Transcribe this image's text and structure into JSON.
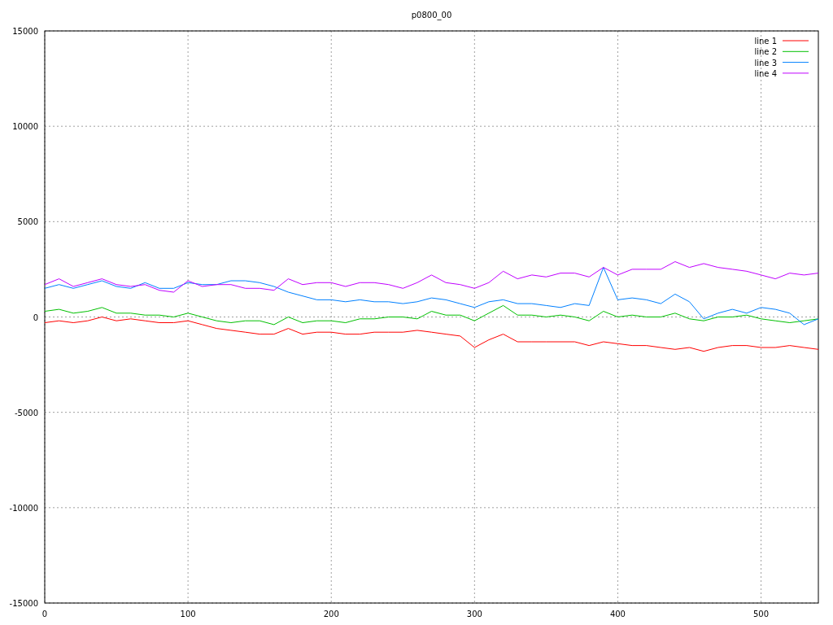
{
  "chart_data": {
    "type": "line",
    "title": "p0800_00",
    "x": [
      0,
      10,
      20,
      30,
      40,
      50,
      60,
      70,
      80,
      90,
      100,
      110,
      120,
      130,
      140,
      150,
      160,
      170,
      180,
      190,
      200,
      210,
      220,
      230,
      240,
      250,
      260,
      270,
      280,
      290,
      300,
      310,
      320,
      330,
      340,
      350,
      360,
      370,
      380,
      390,
      400,
      410,
      420,
      430,
      440,
      450,
      460,
      470,
      480,
      490,
      500,
      510,
      520,
      530,
      540
    ],
    "grid": true,
    "legend": true,
    "xlim": [
      0,
      540
    ],
    "ylim": [
      -15000,
      15000
    ],
    "xticks": [
      0,
      100,
      200,
      300,
      400,
      500
    ],
    "yticks": [
      -15000,
      -10000,
      -5000,
      0,
      5000,
      10000,
      15000
    ],
    "series": [
      {
        "name": "line 1",
        "color": "#ff0000",
        "values": [
          -300,
          -200,
          -300,
          -200,
          0,
          -200,
          -100,
          -200,
          -300,
          -300,
          -200,
          -400,
          -600,
          -700,
          -800,
          -900,
          -900,
          -600,
          -900,
          -800,
          -800,
          -900,
          -900,
          -800,
          -800,
          -800,
          -700,
          -800,
          -900,
          -1000,
          -1600,
          -1200,
          -900,
          -1300,
          -1300,
          -1300,
          -1300,
          -1300,
          -1500,
          -1300,
          -1400,
          -1500,
          -1500,
          -1600,
          -1700,
          -1600,
          -1800,
          -1600,
          -1500,
          -1500,
          -1600,
          -1600,
          -1500,
          -1600,
          -1700
        ]
      },
      {
        "name": "line 2",
        "color": "#00c000",
        "values": [
          300,
          400,
          200,
          300,
          500,
          200,
          200,
          100,
          100,
          0,
          200,
          0,
          -200,
          -300,
          -200,
          -200,
          -400,
          0,
          -300,
          -200,
          -200,
          -300,
          -100,
          -100,
          0,
          0,
          -100,
          300,
          100,
          100,
          -200,
          200,
          600,
          100,
          100,
          0,
          100,
          0,
          -200,
          300,
          0,
          100,
          0,
          0,
          200,
          -100,
          -200,
          0,
          0,
          100,
          -100,
          -200,
          -300,
          -200,
          -100
        ]
      },
      {
        "name": "line 3",
        "color": "#0080ff",
        "values": [
          1500,
          1700,
          1500,
          1700,
          1900,
          1600,
          1500,
          1800,
          1500,
          1500,
          1800,
          1700,
          1700,
          1900,
          1900,
          1800,
          1600,
          1300,
          1100,
          900,
          900,
          800,
          900,
          800,
          800,
          700,
          800,
          1000,
          900,
          700,
          500,
          800,
          900,
          700,
          700,
          600,
          500,
          700,
          600,
          2600,
          900,
          1000,
          900,
          700,
          1200,
          800,
          -100,
          200,
          400,
          200,
          500,
          400,
          200,
          -400,
          -100
        ]
      },
      {
        "name": "line 4",
        "color": "#c000ff",
        "values": [
          1700,
          2000,
          1600,
          1800,
          2000,
          1700,
          1600,
          1700,
          1400,
          1300,
          1900,
          1600,
          1700,
          1700,
          1500,
          1500,
          1400,
          2000,
          1700,
          1800,
          1800,
          1600,
          1800,
          1800,
          1700,
          1500,
          1800,
          2200,
          1800,
          1700,
          1500,
          1800,
          2400,
          2000,
          2200,
          2100,
          2300,
          2300,
          2100,
          2600,
          2200,
          2500,
          2500,
          2500,
          2900,
          2600,
          2800,
          2600,
          2500,
          2400,
          2200,
          2000,
          2300,
          2200,
          2300
        ]
      }
    ]
  }
}
